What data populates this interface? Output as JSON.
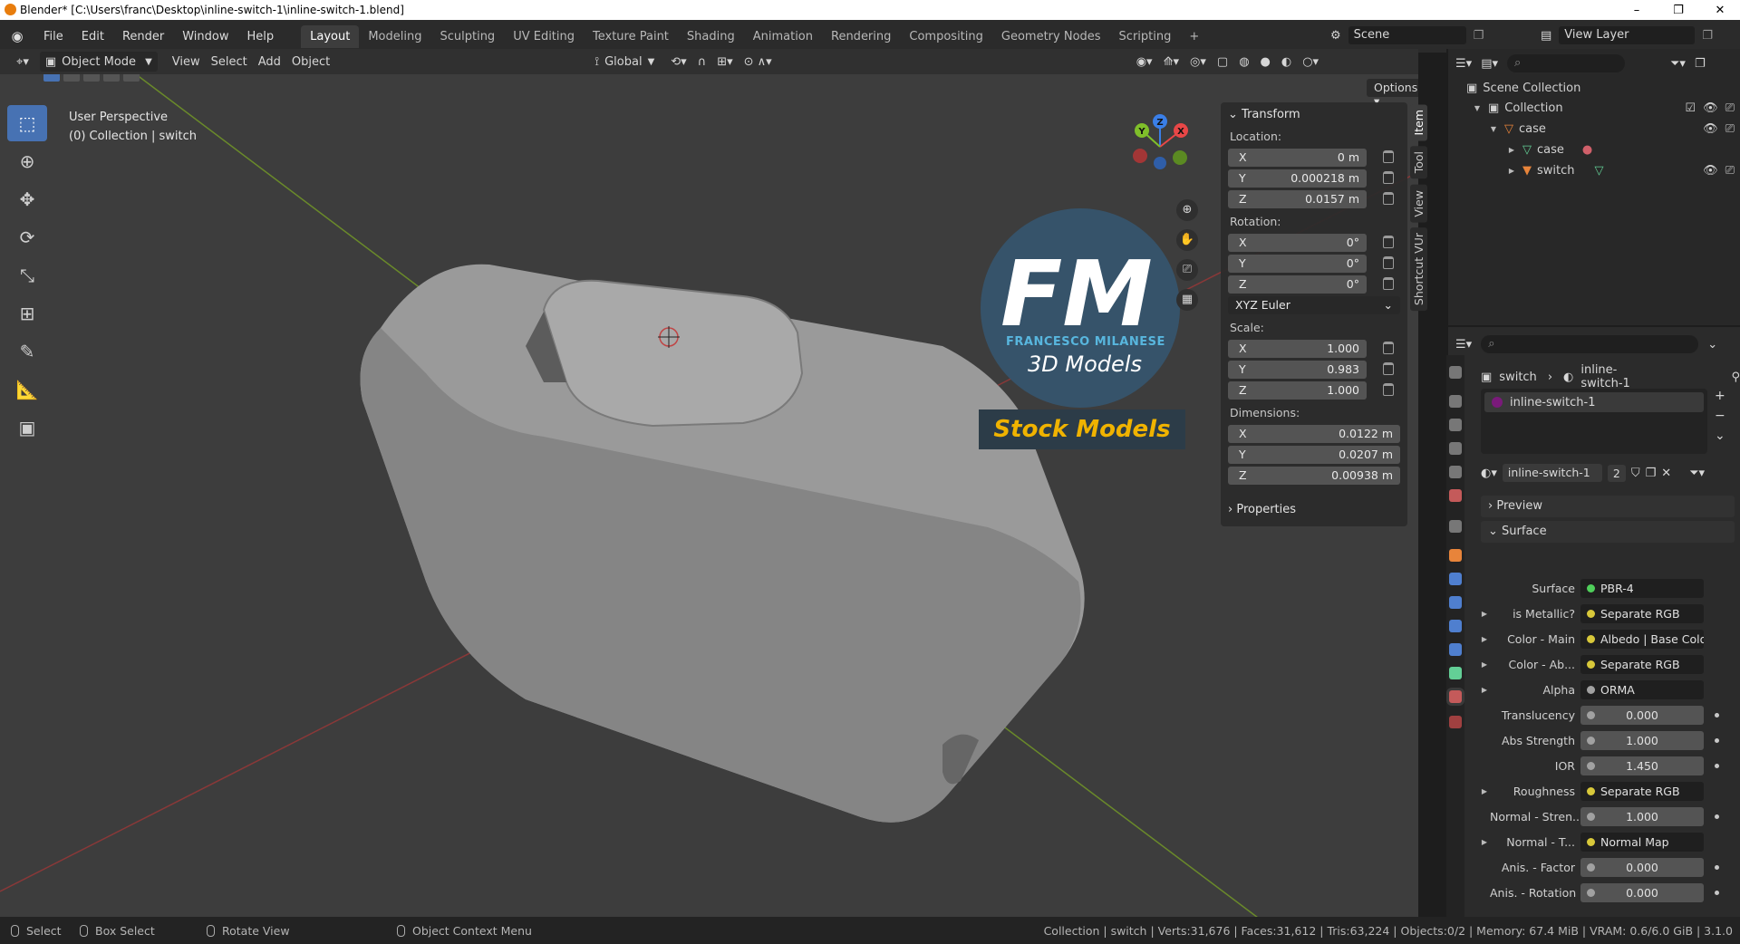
{
  "window": {
    "title": "Blender* [C:\\Users\\franc\\Desktop\\inline-switch-1\\inline-switch-1.blend]",
    "minimize": "–",
    "maximize": "❐",
    "close": "✕"
  },
  "menu": {
    "items": [
      "File",
      "Edit",
      "Render",
      "Window",
      "Help"
    ]
  },
  "workspaces": {
    "tabs": [
      "Layout",
      "Modeling",
      "Sculpting",
      "UV Editing",
      "Texture Paint",
      "Shading",
      "Animation",
      "Rendering",
      "Compositing",
      "Geometry Nodes",
      "Scripting"
    ],
    "add": "+",
    "scene": "Scene",
    "view_layer": "View Layer"
  },
  "viewport_header": {
    "mode": "Object Mode",
    "menus": [
      "View",
      "Select",
      "Add",
      "Object"
    ],
    "orientation": "Global",
    "options": "Options"
  },
  "overlay": {
    "perspective": "User Perspective",
    "context": "(0) Collection | switch"
  },
  "gizmo": {
    "x": "X",
    "y": "Y",
    "z": "Z"
  },
  "watermark": {
    "letters": "FM",
    "name": "FRANCESCO MILANESE",
    "subtitle": "3D Models",
    "banner": "Stock Models"
  },
  "npanel": {
    "section": "Transform",
    "location_label": "Location:",
    "location": [
      {
        "k": "X",
        "v": "0 m"
      },
      {
        "k": "Y",
        "v": "0.000218 m"
      },
      {
        "k": "Z",
        "v": "0.0157 m"
      }
    ],
    "rotation_label": "Rotation:",
    "rotation": [
      {
        "k": "X",
        "v": "0°"
      },
      {
        "k": "Y",
        "v": "0°"
      },
      {
        "k": "Z",
        "v": "0°"
      }
    ],
    "rotation_mode": "XYZ Euler",
    "scale_label": "Scale:",
    "scale": [
      {
        "k": "X",
        "v": "1.000"
      },
      {
        "k": "Y",
        "v": "0.983"
      },
      {
        "k": "Z",
        "v": "1.000"
      }
    ],
    "dimensions_label": "Dimensions:",
    "dimensions": [
      {
        "k": "X",
        "v": "0.0122 m"
      },
      {
        "k": "Y",
        "v": "0.0207 m"
      },
      {
        "k": "Z",
        "v": "0.00938 m"
      }
    ],
    "properties": "Properties",
    "tabs": [
      "Item",
      "Tool",
      "View",
      "Shortcut VUr"
    ]
  },
  "outliner": {
    "scene_collection": "Scene Collection",
    "collection": "Collection",
    "case_parent": "case",
    "case_child": "case",
    "switch": "switch"
  },
  "properties": {
    "breadcrumb_object": "switch",
    "breadcrumb_material": "inline-switch-1",
    "slot": "inline-switch-1",
    "material_name": "inline-switch-1",
    "users": "2",
    "preview": "Preview",
    "surface_section": "Surface",
    "rows": [
      {
        "label": "Surface",
        "value": "PBR-4",
        "dot": "#4fcf5a",
        "num": false,
        "tri": false
      },
      {
        "label": "is Metallic?",
        "value": "Separate RGB",
        "dot": "#d8c83a",
        "num": false,
        "tri": true
      },
      {
        "label": "Color - Main",
        "value": "Albedo | Base Color",
        "dot": "#d8c83a",
        "num": false,
        "tri": true
      },
      {
        "label": "Color - Ab...",
        "value": "Separate RGB",
        "dot": "#d8c83a",
        "num": false,
        "tri": true
      },
      {
        "label": "Alpha",
        "value": "ORMA",
        "dot": "#a1a1a1",
        "num": false,
        "tri": true
      },
      {
        "label": "Translucency",
        "value": "0.000",
        "dot": "#a1a1a1",
        "num": true,
        "tri": false
      },
      {
        "label": "Abs Strength",
        "value": "1.000",
        "dot": "#a1a1a1",
        "num": true,
        "tri": false
      },
      {
        "label": "IOR",
        "value": "1.450",
        "dot": "#a1a1a1",
        "num": true,
        "tri": false
      },
      {
        "label": "Roughness",
        "value": "Separate RGB",
        "dot": "#d8c83a",
        "num": false,
        "tri": true
      },
      {
        "label": "Normal - Stren...",
        "value": "1.000",
        "dot": "#a1a1a1",
        "num": true,
        "tri": false
      },
      {
        "label": "Normal - T...",
        "value": "Normal Map",
        "dot": "#d8c83a",
        "num": false,
        "tri": true
      },
      {
        "label": "Anis. - Factor",
        "value": "0.000",
        "dot": "#a1a1a1",
        "num": true,
        "tri": false
      },
      {
        "label": "Anis. - Rotation",
        "value": "0.000",
        "dot": "#a1a1a1",
        "num": true,
        "tri": false
      }
    ]
  },
  "statusbar": {
    "select": "Select",
    "box_select": "Box Select",
    "rotate_view": "Rotate View",
    "context_menu": "Object Context Menu",
    "stats": "Collection | switch | Verts:31,676 | Faces:31,612 | Tris:63,224 | Objects:0/2 | Memory: 67.4 MiB | VRAM: 0.6/6.0 GiB | 3.1.0"
  }
}
